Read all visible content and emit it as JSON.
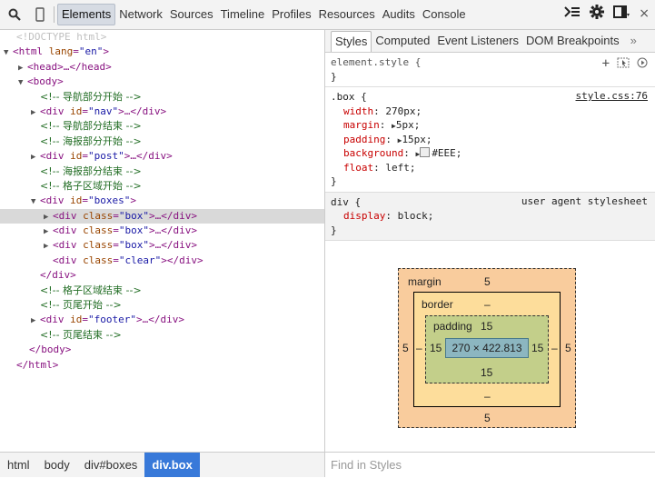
{
  "toolbar": {
    "tabs": [
      "Elements",
      "Network",
      "Sources",
      "Timeline",
      "Profiles",
      "Resources",
      "Audits",
      "Console"
    ],
    "close_label": "×"
  },
  "dom": {
    "doctype": "<!DOCTYPE html>",
    "html_open": "<html",
    "html_attr": "lang",
    "html_val": "\"en\"",
    "head": "<head>…</head>",
    "body_open": "<body>",
    "c_nav_start": "<!-- 导航部分开始 -->",
    "nav_val": "\"nav\"",
    "c_nav_end": "<!-- 导航部分结束 -->",
    "c_post_start": "<!-- 海报部分开始 -->",
    "post_val": "\"post\"",
    "c_post_end": "<!-- 海报部分结束 -->",
    "c_grid_start": "<!-- 格子区域开始 -->",
    "boxes_val": "\"boxes\"",
    "box_val": "\"box\"",
    "clear_val": "\"clear\"",
    "div_close": "</div>",
    "c_grid_end": "<!-- 格子区域结束 -->",
    "c_footer_start": "<!-- 页尾开始 -->",
    "footer_val": "\"footer\"",
    "c_footer_end": "<!-- 页尾结束 -->",
    "body_close": "</body>",
    "html_close": "</html>",
    "collapsed": ">…</div>",
    "div_open": "<div",
    "id_attr": "id",
    "class_attr": "class",
    "gt": ">",
    "empty_close": "></div>"
  },
  "breadcrumbs": [
    "html",
    "body",
    "div#boxes",
    "div.box"
  ],
  "styles_tabs": [
    "Styles",
    "Computed",
    "Event Listeners",
    "DOM Breakpoints"
  ],
  "styles_more": "»",
  "element_style": {
    "selector": "element.style {",
    "close": "}"
  },
  "box_rule": {
    "selector": ".box {",
    "source": "style.css:76",
    "props": [
      {
        "name": "width",
        "value": "270px;",
        "expand": false,
        "swatch": false
      },
      {
        "name": "margin",
        "value": "5px;",
        "expand": true,
        "swatch": false
      },
      {
        "name": "padding",
        "value": "15px;",
        "expand": true,
        "swatch": false
      },
      {
        "name": "background",
        "value": "#EEE;",
        "expand": true,
        "swatch": true
      },
      {
        "name": "float",
        "value": "left;",
        "expand": false,
        "swatch": false
      }
    ],
    "close": "}"
  },
  "ua_rule": {
    "selector": "div {",
    "source": "user agent stylesheet",
    "prop": "display",
    "value": "block;",
    "close": "}"
  },
  "box_model": {
    "margin_label": "margin",
    "margin_top": "5",
    "margin_bottom": "5",
    "margin_left": "5",
    "margin_right": "5",
    "border_label": "border",
    "border_top": "–",
    "border_bottom": "–",
    "border_left": "–",
    "border_right": "–",
    "padding_label": "padding",
    "padding_top": "15",
    "padding_bottom": "15",
    "padding_left": "15",
    "padding_right": "15",
    "content": "270 × 422.813"
  },
  "find_placeholder": "Find in Styles",
  "colors": {
    "selected_crumb": "#3879d9",
    "tag": "#881280",
    "attr": "#994500",
    "value": "#1a1aa6",
    "comment": "#236e25",
    "property": "#c80000"
  }
}
